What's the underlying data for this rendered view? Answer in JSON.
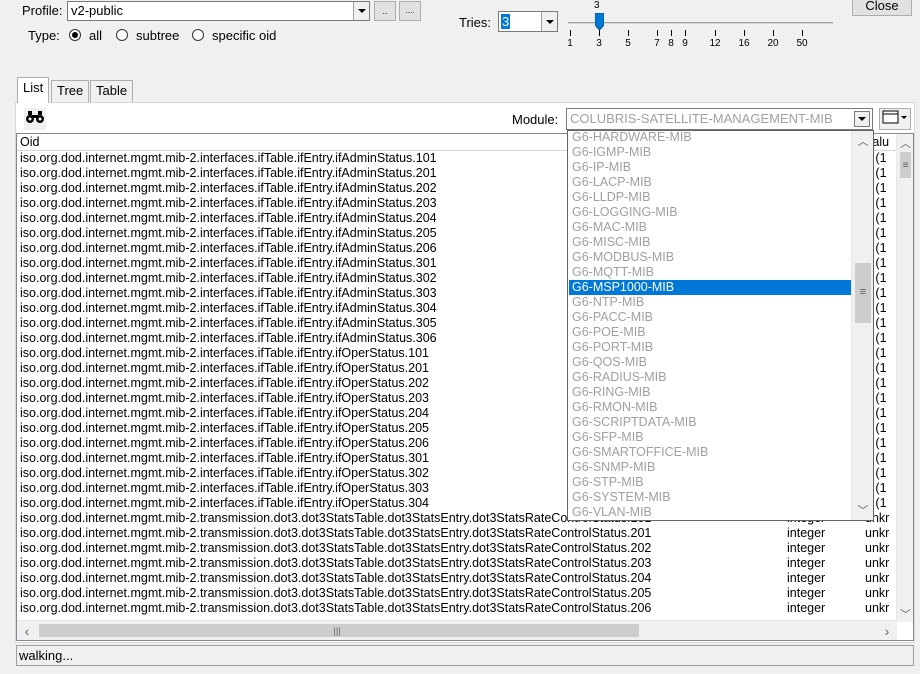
{
  "profile": {
    "label": "Profile:",
    "value": "v2-public",
    "btn1": "..",
    "btn2": "...."
  },
  "type": {
    "label": "Type:",
    "options": [
      "all",
      "subtree",
      "specific oid"
    ],
    "selected": "all"
  },
  "tries": {
    "label": "Tries:",
    "value": "3"
  },
  "slider": {
    "ticks": [
      "1",
      "3",
      "5",
      "7",
      "8",
      "9",
      "12",
      "16",
      "20",
      "50"
    ],
    "current": "3"
  },
  "close_label": "Close",
  "tabs": [
    {
      "label": "List"
    },
    {
      "label": "Tree"
    },
    {
      "label": "Table"
    }
  ],
  "module": {
    "label": "Module:",
    "value": "COLUBRIS-SATELLITE-MANAGEMENT-MIB"
  },
  "table": {
    "headers": {
      "oid": "Oid",
      "value": "Valu"
    },
    "rows": [
      {
        "oid": "iso.org.dod.internet.mgmt.mib-2.interfaces.ifTable.ifEntry.ifAdminStatus.101",
        "type": "",
        "value": "p (1"
      },
      {
        "oid": "iso.org.dod.internet.mgmt.mib-2.interfaces.ifTable.ifEntry.ifAdminStatus.201",
        "type": "",
        "value": "p (1"
      },
      {
        "oid": "iso.org.dod.internet.mgmt.mib-2.interfaces.ifTable.ifEntry.ifAdminStatus.202",
        "type": "",
        "value": "p (1"
      },
      {
        "oid": "iso.org.dod.internet.mgmt.mib-2.interfaces.ifTable.ifEntry.ifAdminStatus.203",
        "type": "",
        "value": "p (1"
      },
      {
        "oid": "iso.org.dod.internet.mgmt.mib-2.interfaces.ifTable.ifEntry.ifAdminStatus.204",
        "type": "",
        "value": "p (1"
      },
      {
        "oid": "iso.org.dod.internet.mgmt.mib-2.interfaces.ifTable.ifEntry.ifAdminStatus.205",
        "type": "",
        "value": "p (1"
      },
      {
        "oid": "iso.org.dod.internet.mgmt.mib-2.interfaces.ifTable.ifEntry.ifAdminStatus.206",
        "type": "",
        "value": "p (1"
      },
      {
        "oid": "iso.org.dod.internet.mgmt.mib-2.interfaces.ifTable.ifEntry.ifAdminStatus.301",
        "type": "",
        "value": "p (1"
      },
      {
        "oid": "iso.org.dod.internet.mgmt.mib-2.interfaces.ifTable.ifEntry.ifAdminStatus.302",
        "type": "",
        "value": "p (1"
      },
      {
        "oid": "iso.org.dod.internet.mgmt.mib-2.interfaces.ifTable.ifEntry.ifAdminStatus.303",
        "type": "",
        "value": "p (1"
      },
      {
        "oid": "iso.org.dod.internet.mgmt.mib-2.interfaces.ifTable.ifEntry.ifAdminStatus.304",
        "type": "",
        "value": "p (1"
      },
      {
        "oid": "iso.org.dod.internet.mgmt.mib-2.interfaces.ifTable.ifEntry.ifAdminStatus.305",
        "type": "",
        "value": "p (1"
      },
      {
        "oid": "iso.org.dod.internet.mgmt.mib-2.interfaces.ifTable.ifEntry.ifAdminStatus.306",
        "type": "",
        "value": "p (1"
      },
      {
        "oid": "iso.org.dod.internet.mgmt.mib-2.interfaces.ifTable.ifEntry.ifOperStatus.101",
        "type": "",
        "value": "p (1"
      },
      {
        "oid": "iso.org.dod.internet.mgmt.mib-2.interfaces.ifTable.ifEntry.ifOperStatus.201",
        "type": "",
        "value": "p (1"
      },
      {
        "oid": "iso.org.dod.internet.mgmt.mib-2.interfaces.ifTable.ifEntry.ifOperStatus.202",
        "type": "",
        "value": "p (1"
      },
      {
        "oid": "iso.org.dod.internet.mgmt.mib-2.interfaces.ifTable.ifEntry.ifOperStatus.203",
        "type": "",
        "value": "p (1"
      },
      {
        "oid": "iso.org.dod.internet.mgmt.mib-2.interfaces.ifTable.ifEntry.ifOperStatus.204",
        "type": "",
        "value": "p (1"
      },
      {
        "oid": "iso.org.dod.internet.mgmt.mib-2.interfaces.ifTable.ifEntry.ifOperStatus.205",
        "type": "",
        "value": "p (1"
      },
      {
        "oid": "iso.org.dod.internet.mgmt.mib-2.interfaces.ifTable.ifEntry.ifOperStatus.206",
        "type": "",
        "value": "p (1"
      },
      {
        "oid": "iso.org.dod.internet.mgmt.mib-2.interfaces.ifTable.ifEntry.ifOperStatus.301",
        "type": "",
        "value": "p (1"
      },
      {
        "oid": "iso.org.dod.internet.mgmt.mib-2.interfaces.ifTable.ifEntry.ifOperStatus.302",
        "type": "",
        "value": "p (1"
      },
      {
        "oid": "iso.org.dod.internet.mgmt.mib-2.interfaces.ifTable.ifEntry.ifOperStatus.303",
        "type": "",
        "value": "p (1"
      },
      {
        "oid": "iso.org.dod.internet.mgmt.mib-2.interfaces.ifTable.ifEntry.ifOperStatus.304",
        "type": "",
        "value": "p (1"
      },
      {
        "oid": "iso.org.dod.internet.mgmt.mib-2.transmission.dot3.dot3StatsTable.dot3StatsEntry.dot3StatsRateControlStatus.101",
        "type": "integer",
        "value": "unkr"
      },
      {
        "oid": "iso.org.dod.internet.mgmt.mib-2.transmission.dot3.dot3StatsTable.dot3StatsEntry.dot3StatsRateControlStatus.201",
        "type": "integer",
        "value": "unkr"
      },
      {
        "oid": "iso.org.dod.internet.mgmt.mib-2.transmission.dot3.dot3StatsTable.dot3StatsEntry.dot3StatsRateControlStatus.202",
        "type": "integer",
        "value": "unkr"
      },
      {
        "oid": "iso.org.dod.internet.mgmt.mib-2.transmission.dot3.dot3StatsTable.dot3StatsEntry.dot3StatsRateControlStatus.203",
        "type": "integer",
        "value": "unkr"
      },
      {
        "oid": "iso.org.dod.internet.mgmt.mib-2.transmission.dot3.dot3StatsTable.dot3StatsEntry.dot3StatsRateControlStatus.204",
        "type": "integer",
        "value": "unkr"
      },
      {
        "oid": "iso.org.dod.internet.mgmt.mib-2.transmission.dot3.dot3StatsTable.dot3StatsEntry.dot3StatsRateControlStatus.205",
        "type": "integer",
        "value": "unkr"
      },
      {
        "oid": "iso.org.dod.internet.mgmt.mib-2.transmission.dot3.dot3StatsTable.dot3StatsEntry.dot3StatsRateControlStatus.206",
        "type": "integer",
        "value": "unkr"
      }
    ]
  },
  "dropdown": {
    "items": [
      "G6-HARDWARE-MIB",
      "G6-IGMP-MIB",
      "G6-IP-MIB",
      "G6-LACP-MIB",
      "G6-LLDP-MIB",
      "G6-LOGGING-MIB",
      "G6-MAC-MIB",
      "G6-MISC-MIB",
      "G6-MODBUS-MIB",
      "G6-MQTT-MIB",
      "G6-MSP1000-MIB",
      "G6-NTP-MIB",
      "G6-PACC-MIB",
      "G6-POE-MIB",
      "G6-PORT-MIB",
      "G6-QOS-MIB",
      "G6-RADIUS-MIB",
      "G6-RING-MIB",
      "G6-RMON-MIB",
      "G6-SCRIPTDATA-MIB",
      "G6-SFP-MIB",
      "G6-SMARTOFFICE-MIB",
      "G6-SNMP-MIB",
      "G6-STP-MIB",
      "G6-SYSTEM-MIB",
      "G6-VLAN-MIB"
    ],
    "selected": "G6-MSP1000-MIB"
  },
  "status": "walking...",
  "colors": {
    "selection": "#0078d7",
    "disabled_text": "#a0a0a0"
  }
}
